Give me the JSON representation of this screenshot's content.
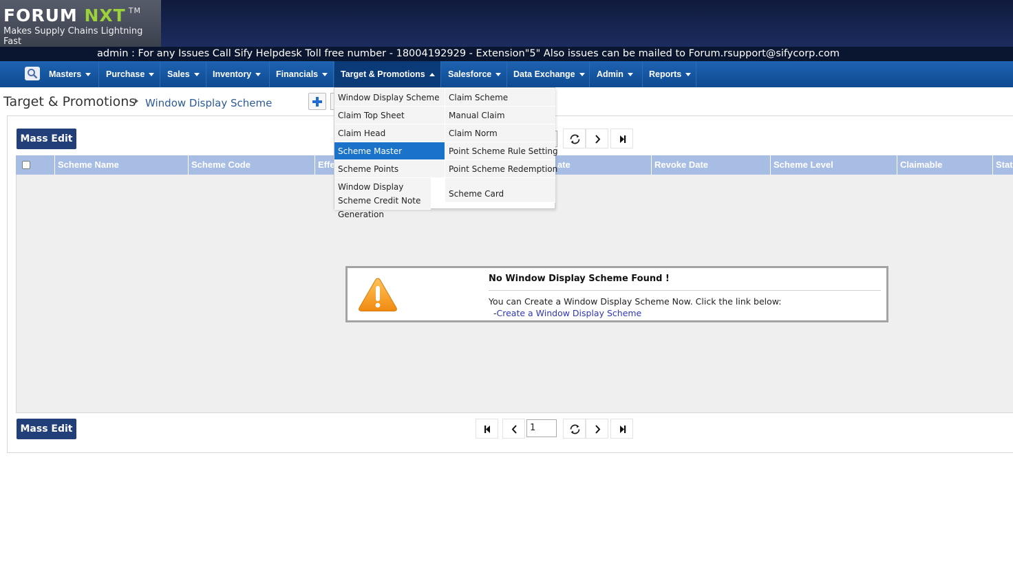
{
  "brand": {
    "name_part1": "FORUM",
    "name_part2": "NXT",
    "trademark": "TM",
    "tagline": "Makes Supply Chains Lightning Fast"
  },
  "notice": "admin : For any Issues Call Sify Helpdesk Toll free number - 18004192929 - Extension\"5\" Also issues can be mailed to Forum.rsupport@sifycorp.com",
  "nav": {
    "search_icon": "search-icon",
    "items": [
      {
        "label": "Masters"
      },
      {
        "label": "Purchase"
      },
      {
        "label": "Sales"
      },
      {
        "label": "Inventory"
      },
      {
        "label": "Financials"
      },
      {
        "label": "Target & Promotions",
        "active": true
      },
      {
        "label": "Salesforce"
      },
      {
        "label": "Data Exchange"
      },
      {
        "label": "Admin"
      },
      {
        "label": "Reports"
      }
    ]
  },
  "dropdown": {
    "left_items": [
      {
        "label": "Window Display Scheme"
      },
      {
        "label": "Claim Top Sheet"
      },
      {
        "label": "Claim Head"
      },
      {
        "label": "Scheme Master",
        "selected": true
      },
      {
        "label": "Scheme Points"
      },
      {
        "label": "Window Display Scheme Credit Note Generation"
      }
    ],
    "right_items": [
      {
        "label": "Claim Scheme"
      },
      {
        "label": "Manual Claim"
      },
      {
        "label": "Claim Norm"
      },
      {
        "label": "Point Scheme Rule Setting"
      },
      {
        "label": "Point Scheme Redemption"
      },
      {
        "label": "Scheme Card"
      }
    ]
  },
  "breadcrumb": {
    "root": "Target & Promotions",
    "current": "Window Display Scheme"
  },
  "toolbar": {
    "mass_edit_label": "Mass Edit"
  },
  "grid": {
    "columns": [
      "Scheme Name",
      "Scheme Code",
      "Effe",
      "ate",
      "Revoke Date",
      "Scheme Level",
      "Claimable",
      "Stat"
    ]
  },
  "pager": {
    "page_value": "1"
  },
  "empty_state": {
    "title": "No Window Display Scheme Found !",
    "message": "You can Create a Window Display Scheme Now. Click the link below:",
    "link_prefix": "-",
    "link_label": "Create a Window Display Scheme"
  },
  "colors": {
    "nav": "#1e63b1",
    "header": "#1c2c5e",
    "grid_header": "#a8bde3",
    "button": "#223f7a",
    "selected_menu": "#1a73c9",
    "brand_accent": "#9bd13b"
  }
}
